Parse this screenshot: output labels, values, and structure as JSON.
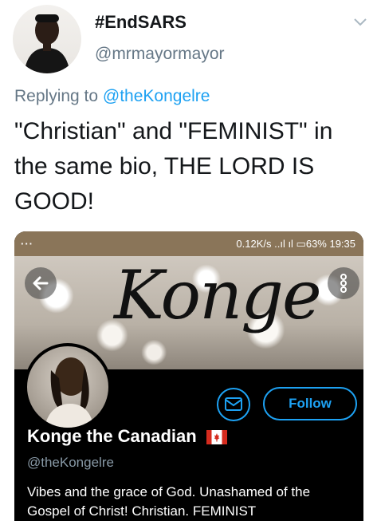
{
  "tweet": {
    "display_name": "#EndSARS",
    "handle": "@mrmayormayor",
    "replying_prefix": "Replying to ",
    "replying_to": "@theKongelre",
    "text": "\"Christian\" and \"FEMINIST\" in the same bio, THE LORD IS GOOD!"
  },
  "screenshot": {
    "status_left": "··· ",
    "status_right": "0.12K/s ..ıl ıl ▭63% 19:35",
    "banner_text": "Konge",
    "follow_label": "Follow",
    "profile_name": "Konge the Canadian",
    "profile_handle": "@theKongelre",
    "bio": "Vibes and the grace of God. Unashamed of the Gospel of Christ!  Christian. FEMINIST"
  },
  "colors": {
    "accent": "#1da1f2",
    "muted": "#657786",
    "status_bar": "#8a7559",
    "dark_bg": "#000000"
  },
  "icons": {
    "avatar": "user-avatar",
    "chevron": "chevron-down-icon",
    "back": "arrow-left-icon",
    "more": "more-vertical-icon",
    "message": "mail-icon",
    "flag": "canada-flag-icon"
  }
}
